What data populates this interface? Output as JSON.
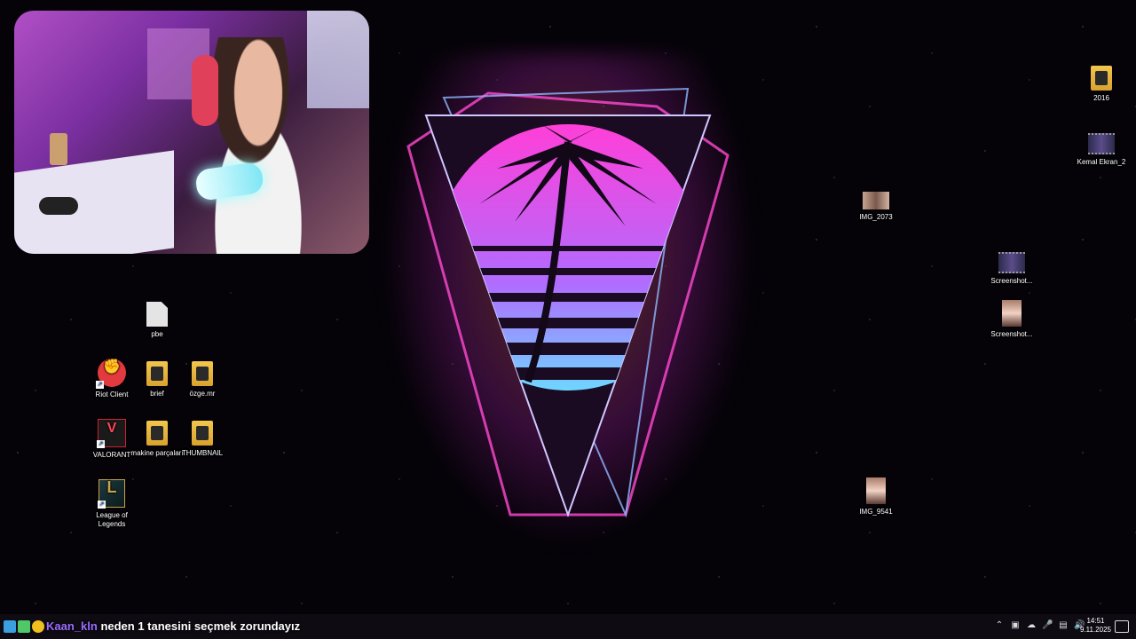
{
  "desktop": {
    "icons": {
      "pbe": "pbe",
      "riot_client": "Riot Client",
      "brief": "brief",
      "ozge": "özge.mr",
      "valorant": "VALORANT",
      "makine_parcalari": "makine parçaları",
      "thumbnail": "THUMBNAIL",
      "league": "League of Legends",
      "folder_2016": "2016",
      "kemal_ekran": "Kemal Ekran_2",
      "img_2073": "IMG_2073",
      "screenshot_1": "Screenshot...",
      "screenshot_2": "Screenshot...",
      "img_9541": "IMG_9541"
    }
  },
  "chat": {
    "username": "Kaan_kln",
    "message": "neden 1 tanesini seçmek zorundayız"
  },
  "taskbar": {
    "time": "14:51",
    "date": "9.11.2025",
    "tray_icons": [
      "chevron-up-icon",
      "meet-now-icon",
      "onedrive-icon",
      "microphone-icon",
      "network-icon",
      "volume-icon"
    ]
  }
}
